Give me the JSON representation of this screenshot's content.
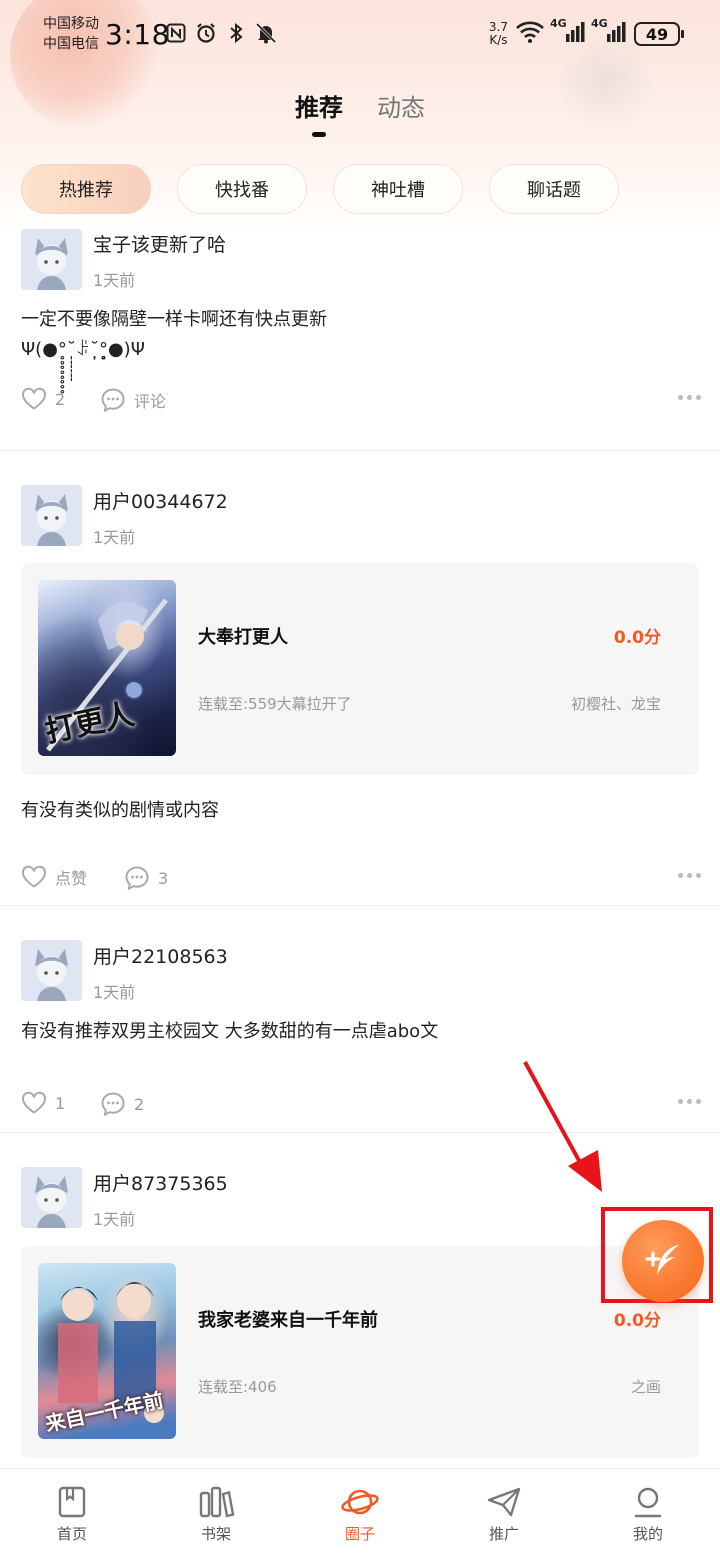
{
  "status_bar": {
    "carrier_1": "中国移动",
    "carrier_2": "中国电信",
    "time": "3:18",
    "speed_value": "3.7",
    "speed_unit": "K/s",
    "network_1": "4G",
    "network_2": "4G",
    "battery": "49",
    "icons": [
      "nfc-icon",
      "alarm-icon",
      "bluetooth-icon",
      "mute-bell-icon",
      "wifi-icon",
      "signal-icon",
      "signal-icon"
    ]
  },
  "top_tabs": [
    {
      "label": "推荐",
      "active": true
    },
    {
      "label": "动态",
      "active": false
    }
  ],
  "chips": [
    {
      "label": "热推荐",
      "active": true
    },
    {
      "label": "快找番",
      "active": false
    },
    {
      "label": "神吐槽",
      "active": false
    },
    {
      "label": "聊话题",
      "active": false
    }
  ],
  "posts": [
    {
      "username": "宝子该更新了哈",
      "time": "1天前",
      "text_line1": "一定不要像隔壁一样卡啊还有快点更新",
      "text_line2": "Ψ(●°̥̥̥̥̥̥̥̥˘̩̩̩̩̩̩ꌠ˘̩̩̩̩̩̩°̥̥̥̥̥̥̥̥●)Ψ",
      "likes": "2",
      "comments": "评论"
    },
    {
      "username": "用户00344672",
      "time": "1天前",
      "comic": {
        "title": "大奉打更人",
        "cover_text": "打更人",
        "score": "0.0分",
        "chapter": "连载至:559大幕拉开了",
        "authors": "初樱社、龙宝"
      },
      "text": "有没有类似的剧情或内容",
      "likes": "点赞",
      "comments": "3"
    },
    {
      "username": "用户22108563",
      "time": "1天前",
      "text": "有没有推荐双男主校园文 大多数甜的有一点虐abo文",
      "likes": "1",
      "comments": "2"
    },
    {
      "username": "用户87375365",
      "time": "1天前",
      "comic": {
        "title": "我家老婆来自一千年前",
        "cover_text": "来自一千年前",
        "score": "0.0分",
        "chapter": "连载至:406",
        "authors": "之画"
      }
    }
  ],
  "bottom_nav": [
    {
      "label": "首页",
      "icon": "book-icon",
      "active": false
    },
    {
      "label": "书架",
      "icon": "bookshelf-icon",
      "active": false
    },
    {
      "label": "圈子",
      "icon": "planet-icon",
      "active": true
    },
    {
      "label": "推广",
      "icon": "paper-plane-icon",
      "active": false
    },
    {
      "label": "我的",
      "icon": "user-icon",
      "active": false
    }
  ],
  "colors": {
    "accent": "#f15a22",
    "fab": "#f9792f",
    "highlight_box": "#e8141a"
  }
}
